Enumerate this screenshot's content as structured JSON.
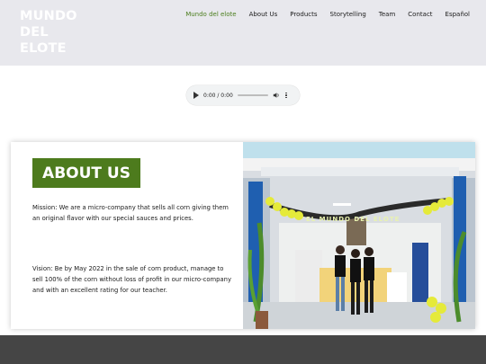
{
  "logo": {
    "line1": "MUNDO",
    "line2": "DEL",
    "line3": "ELOTE"
  },
  "nav": [
    {
      "label": "Mundo del elote",
      "active": true
    },
    {
      "label": "About Us",
      "active": false
    },
    {
      "label": "Products",
      "active": false
    },
    {
      "label": "Storytelling",
      "active": false
    },
    {
      "label": "Team",
      "active": false
    },
    {
      "label": "Contact",
      "active": false
    },
    {
      "label": "Español",
      "active": false
    }
  ],
  "audio": {
    "time": "0:00 / 0:00",
    "progress": 0
  },
  "about": {
    "heading": "ABOUT US",
    "mission": "Mission: We are a micro-company that sells all corn giving them an original flavor with our special sauces and prices.",
    "vision": "Vision: Be by May 2022 in the sale of corn product, manage to sell 100% of the corn without loss of profit in our micro-company and with an excellent rating for our teacher."
  },
  "photo": {
    "banner_text": "EL MUNDO DEL ELOTE"
  },
  "colors": {
    "accent": "#4d7b1d",
    "nav_active": "#4a7d1c",
    "header_bg": "#e8e8ed",
    "footer_bg": "#454545"
  }
}
